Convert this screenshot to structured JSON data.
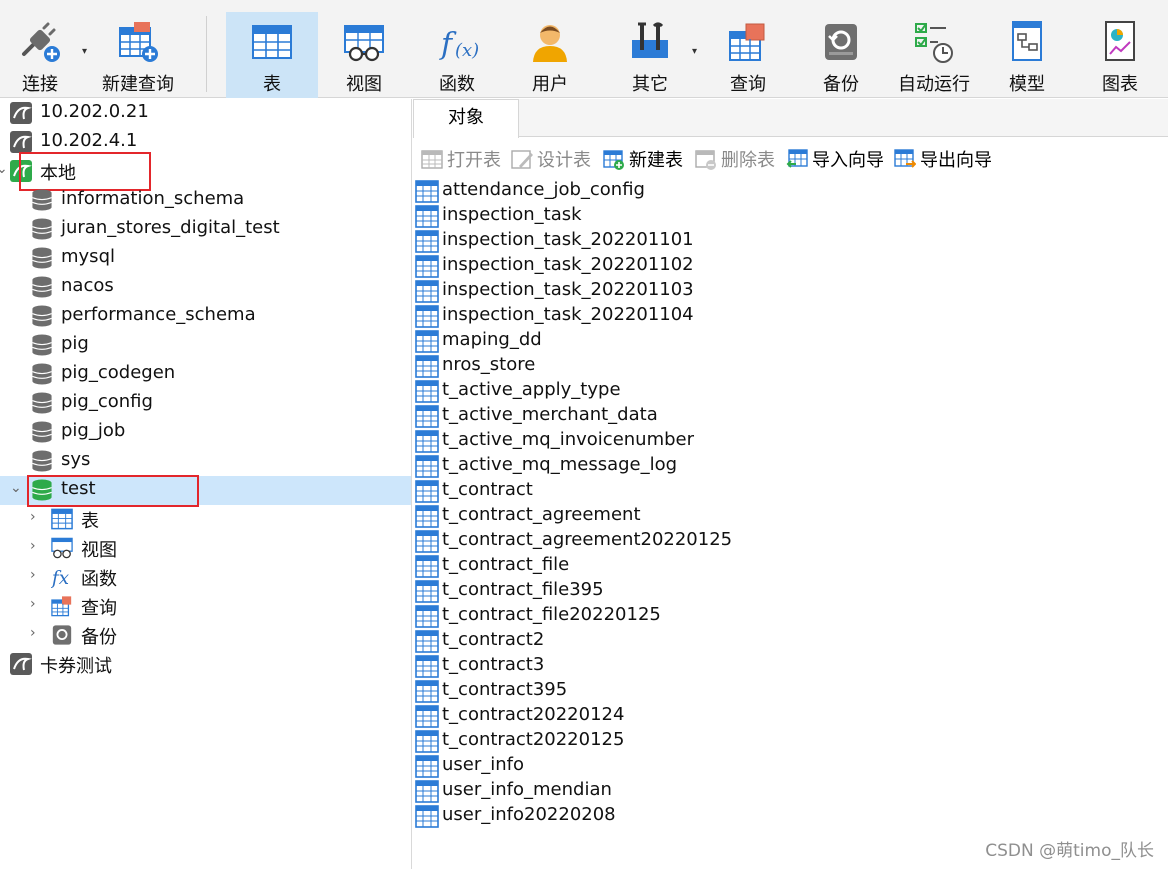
{
  "toolbar": {
    "buttons": [
      {
        "label": "连接",
        "icon": "plug-connect-icon"
      },
      {
        "label": "新建查询",
        "icon": "new-query-icon"
      },
      {
        "label": "表",
        "icon": "table-icon"
      },
      {
        "label": "视图",
        "icon": "view-glasses-icon"
      },
      {
        "label": "函数",
        "icon": "function-fx-icon"
      },
      {
        "label": "用户",
        "icon": "user-icon"
      },
      {
        "label": "其它",
        "icon": "tools-icon"
      },
      {
        "label": "查询",
        "icon": "query-icon"
      },
      {
        "label": "备份",
        "icon": "backup-icon"
      },
      {
        "label": "自动运行",
        "icon": "auto-run-icon"
      },
      {
        "label": "模型",
        "icon": "model-icon"
      },
      {
        "label": "图表",
        "icon": "chart-icon"
      }
    ],
    "active": "表"
  },
  "tree": {
    "connections": [
      "10.202.0.21",
      "10.202.4.1",
      "本地"
    ],
    "databases": [
      "information_schema",
      "juran_stores_digital_test",
      "mysql",
      "nacos",
      "performance_schema",
      "pig",
      "pig_codegen",
      "pig_config",
      "pig_job",
      "sys",
      "test"
    ],
    "test_children": [
      "表",
      "视图",
      "函数",
      "查询",
      "备份"
    ],
    "last_connection": "卡券测试"
  },
  "tabs": {
    "object": "对象"
  },
  "actions": {
    "open_table": "打开表",
    "design_table": "设计表",
    "new_table": "新建表",
    "delete_table": "删除表",
    "import_wizard": "导入向导",
    "export_wizard": "导出向导"
  },
  "tables": [
    "attendance_job_config",
    "inspection_task",
    "inspection_task_202201101",
    "inspection_task_202201102",
    "inspection_task_202201103",
    "inspection_task_202201104",
    "maping_dd",
    "nros_store",
    "t_active_apply_type",
    "t_active_merchant_data",
    "t_active_mq_invoicenumber",
    "t_active_mq_message_log",
    "t_contract",
    "t_contract_agreement",
    "t_contract_agreement20220125",
    "t_contract_file",
    "t_contract_file395",
    "t_contract_file20220125",
    "t_contract2",
    "t_contract3",
    "t_contract395",
    "t_contract20220124",
    "t_contract20220125",
    "user_info",
    "user_info_mendian",
    "user_info20220208"
  ],
  "watermark": "CSDN @萌timo_队长",
  "colors": {
    "accent": "#2b7bd6",
    "selection": "#cde6fb",
    "highlight_box": "#e3262b",
    "db_active": "#2eaa4a"
  }
}
